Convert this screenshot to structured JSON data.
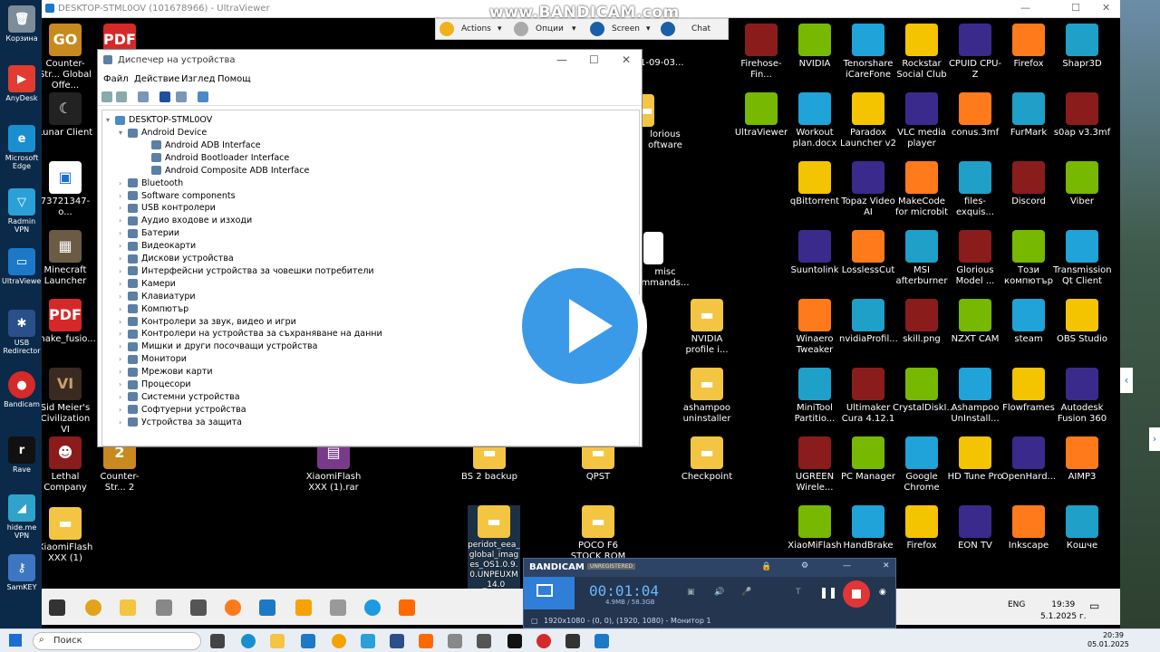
{
  "watermark": "www.BANDICAM.com",
  "ultraviewer": {
    "title": "DESKTOP-STML0OV (101678966) - UltraViewer",
    "toolbar": {
      "actions": "Actions",
      "options": "Опции",
      "screen": "Screen",
      "chat": "Chat"
    }
  },
  "device_manager": {
    "title": "Диспечер на устройства",
    "menu": [
      "Файл",
      "Действие",
      "Изглед",
      "Помощ"
    ],
    "root": "DESKTOP-STML0OV",
    "tree": [
      {
        "label": "Android Device",
        "level": 1,
        "expanded": true
      },
      {
        "label": "Android ADB Interface",
        "level": 2
      },
      {
        "label": "Android Bootloader Interface",
        "level": 2
      },
      {
        "label": "Android Composite ADB Interface",
        "level": 2
      },
      {
        "label": "Bluetooth",
        "level": 1
      },
      {
        "label": "Software components",
        "level": 1
      },
      {
        "label": "USB контролери",
        "level": 1
      },
      {
        "label": "Аудио входове и изходи",
        "level": 1
      },
      {
        "label": "Батерии",
        "level": 1
      },
      {
        "label": "Видеокарти",
        "level": 1
      },
      {
        "label": "Дискови устройства",
        "level": 1
      },
      {
        "label": "Интерфейсни устройства за човешки потребители",
        "level": 1
      },
      {
        "label": "Камери",
        "level": 1
      },
      {
        "label": "Клавиатури",
        "level": 1
      },
      {
        "label": "Компютър",
        "level": 1
      },
      {
        "label": "Контролери за звук, видео и игри",
        "level": 1
      },
      {
        "label": "Контролери на устройства за съхраняване на данни",
        "level": 1
      },
      {
        "label": "Мишки и други посочващи устройства",
        "level": 1
      },
      {
        "label": "Монитори",
        "level": 1
      },
      {
        "label": "Мрежови карти",
        "level": 1
      },
      {
        "label": "Процесори",
        "level": 1
      },
      {
        "label": "Системни устройства",
        "level": 1
      },
      {
        "label": "Софтуерни устройства",
        "level": 1
      },
      {
        "label": "Устройства за защита",
        "level": 1
      }
    ]
  },
  "local_icons": [
    "Корзина",
    "AnyDesk",
    "Microsoft Edge",
    "Radmin VPN",
    "UltraViewer",
    "USB Redirector",
    "Bandicam",
    "Rave",
    "hide.me VPN",
    "SamKEY"
  ],
  "desktop_icons": {
    "col1": [
      "Counter-Str... Global Offe...",
      "Lunar Client",
      "73721347-o...",
      "Minecraft Launcher",
      "make_fusio...",
      "Sid Meier's Civilization VI",
      "Lethal Company",
      "XiaomiFlash XXX (1)"
    ],
    "misc": [
      "Counter-Str... 2",
      "XiaomiFlash XXX (1).rar",
      "BS 2 backup",
      "QPST",
      "Checkpoint",
      "peridot_eea_global_images_OS1.0.9.0.UNPEUXM_14.0",
      "POCO F6 STOCK ROM",
      "1-09-03...",
      "lorious oftware",
      "misc mmands...",
      "NVIDIA profile i...",
      "ashampoo uninstaller"
    ],
    "grid": [
      [
        "Firehose-Fin...",
        "NVIDIA",
        "Tenorshare iCareFone",
        "Rockstar Social Club",
        "CPUID CPU-Z",
        "Firefox",
        "Shapr3D"
      ],
      [
        "UltraViewer",
        "Workout plan.docx",
        "Paradox Launcher v2",
        "VLC media player",
        "conus.3mf",
        "FurMark",
        "s0ap v3.3mf"
      ],
      [
        "",
        "qBittorrent",
        "Topaz Video AI",
        "MakeCode for microbit",
        "files-exquis...",
        "Discord",
        "Viber"
      ],
      [
        "",
        "Suuntolink",
        "LosslessCut",
        "MSI afterburner",
        "Glorious Model ...",
        "Този компютър",
        "Transmission Qt Client"
      ],
      [
        "",
        "Winaero Tweaker",
        "nvidiaProfil...",
        "skill.png",
        "NZXT CAM",
        "steam",
        "OBS Studio"
      ],
      [
        "",
        "MiniTool Partitio...",
        "Ultimaker Cura 4.12.1",
        "CrystalDiskI...",
        "Ashampoo UnInstall...",
        "Flowframes",
        "Autodesk Fusion 360"
      ],
      [
        "",
        "UGREEN Wirele...",
        "PC Manager",
        "Google Chrome",
        "HD Tune Pro",
        "OpenHard...",
        "AIMP3"
      ],
      [
        "",
        "XiaoMiFlash",
        "HandBrake",
        "Firefox",
        "EON TV",
        "Inkscape",
        "Кошче"
      ]
    ]
  },
  "bandicam": {
    "logo": "BANDICAM",
    "unregistered": "UNREGISTERED",
    "timer": "00:01:04",
    "size": "4.9MB / 58.3GB",
    "resolution": "1920x1080 - (0, 0), (1920, 1080) - Монитор 1"
  },
  "remote_taskbar": {
    "lang": "ENG",
    "time": "19:39",
    "date": "5.1.2025 г."
  },
  "local_taskbar": {
    "search": "Поиск",
    "time": "20:39",
    "date": "05.01.2025"
  }
}
